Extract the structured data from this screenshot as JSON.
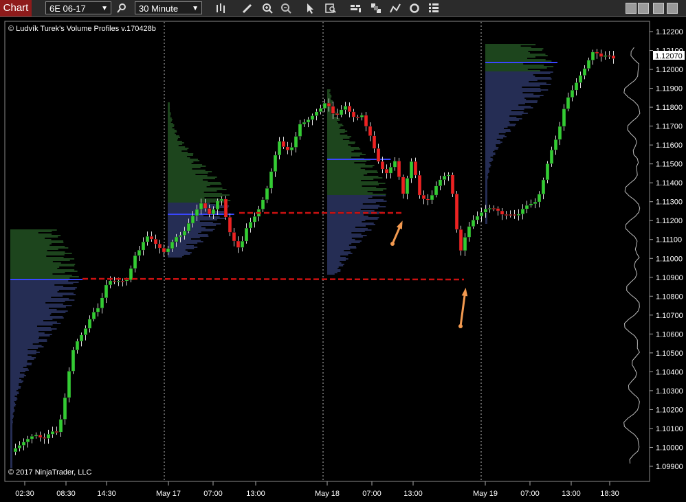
{
  "toolbar": {
    "chart_label": "Chart",
    "instrument": "6E 06-17",
    "interval": "30 Minute"
  },
  "chart": {
    "indicator_label": "© Ludvík Turek's Volume Profiles v.170428b",
    "copyright": "© 2017 NinjaTrader, LLC",
    "current_price": "1.12070"
  },
  "chart_data": {
    "type": "candlestick",
    "instrument": "6E 06-17",
    "interval": "30 Minute",
    "y_ticks": [
      "1.12200",
      "1.12100",
      "1.12000",
      "1.11900",
      "1.11800",
      "1.11700",
      "1.11600",
      "1.11500",
      "1.11400",
      "1.11300",
      "1.11200",
      "1.11100",
      "1.11000",
      "1.10900",
      "1.10800",
      "1.10700",
      "1.10600",
      "1.10500",
      "1.10400",
      "1.10300",
      "1.10200",
      "1.10100",
      "1.10000",
      "1.09900"
    ],
    "x_ticks": [
      "02:30",
      "08:30",
      "14:30",
      "May 17",
      "07:00",
      "13:00",
      "May 18",
      "07:00",
      "13:00",
      "May 19",
      "07:00",
      "13:00",
      "18:30"
    ],
    "ylim": [
      1.0988,
      1.1224
    ],
    "session_dividers": [
      "May 17",
      "May 18",
      "May 19"
    ],
    "support_levels": [
      1.1124,
      1.1089
    ],
    "colors": {
      "up": "#33cc33",
      "down": "#ee2222",
      "buy_profile": "#3a8a3a",
      "sell_profile": "#4a5aa8",
      "poc": "#3a46ff",
      "level": "#cc1111",
      "arrow": "#f39a50"
    }
  }
}
